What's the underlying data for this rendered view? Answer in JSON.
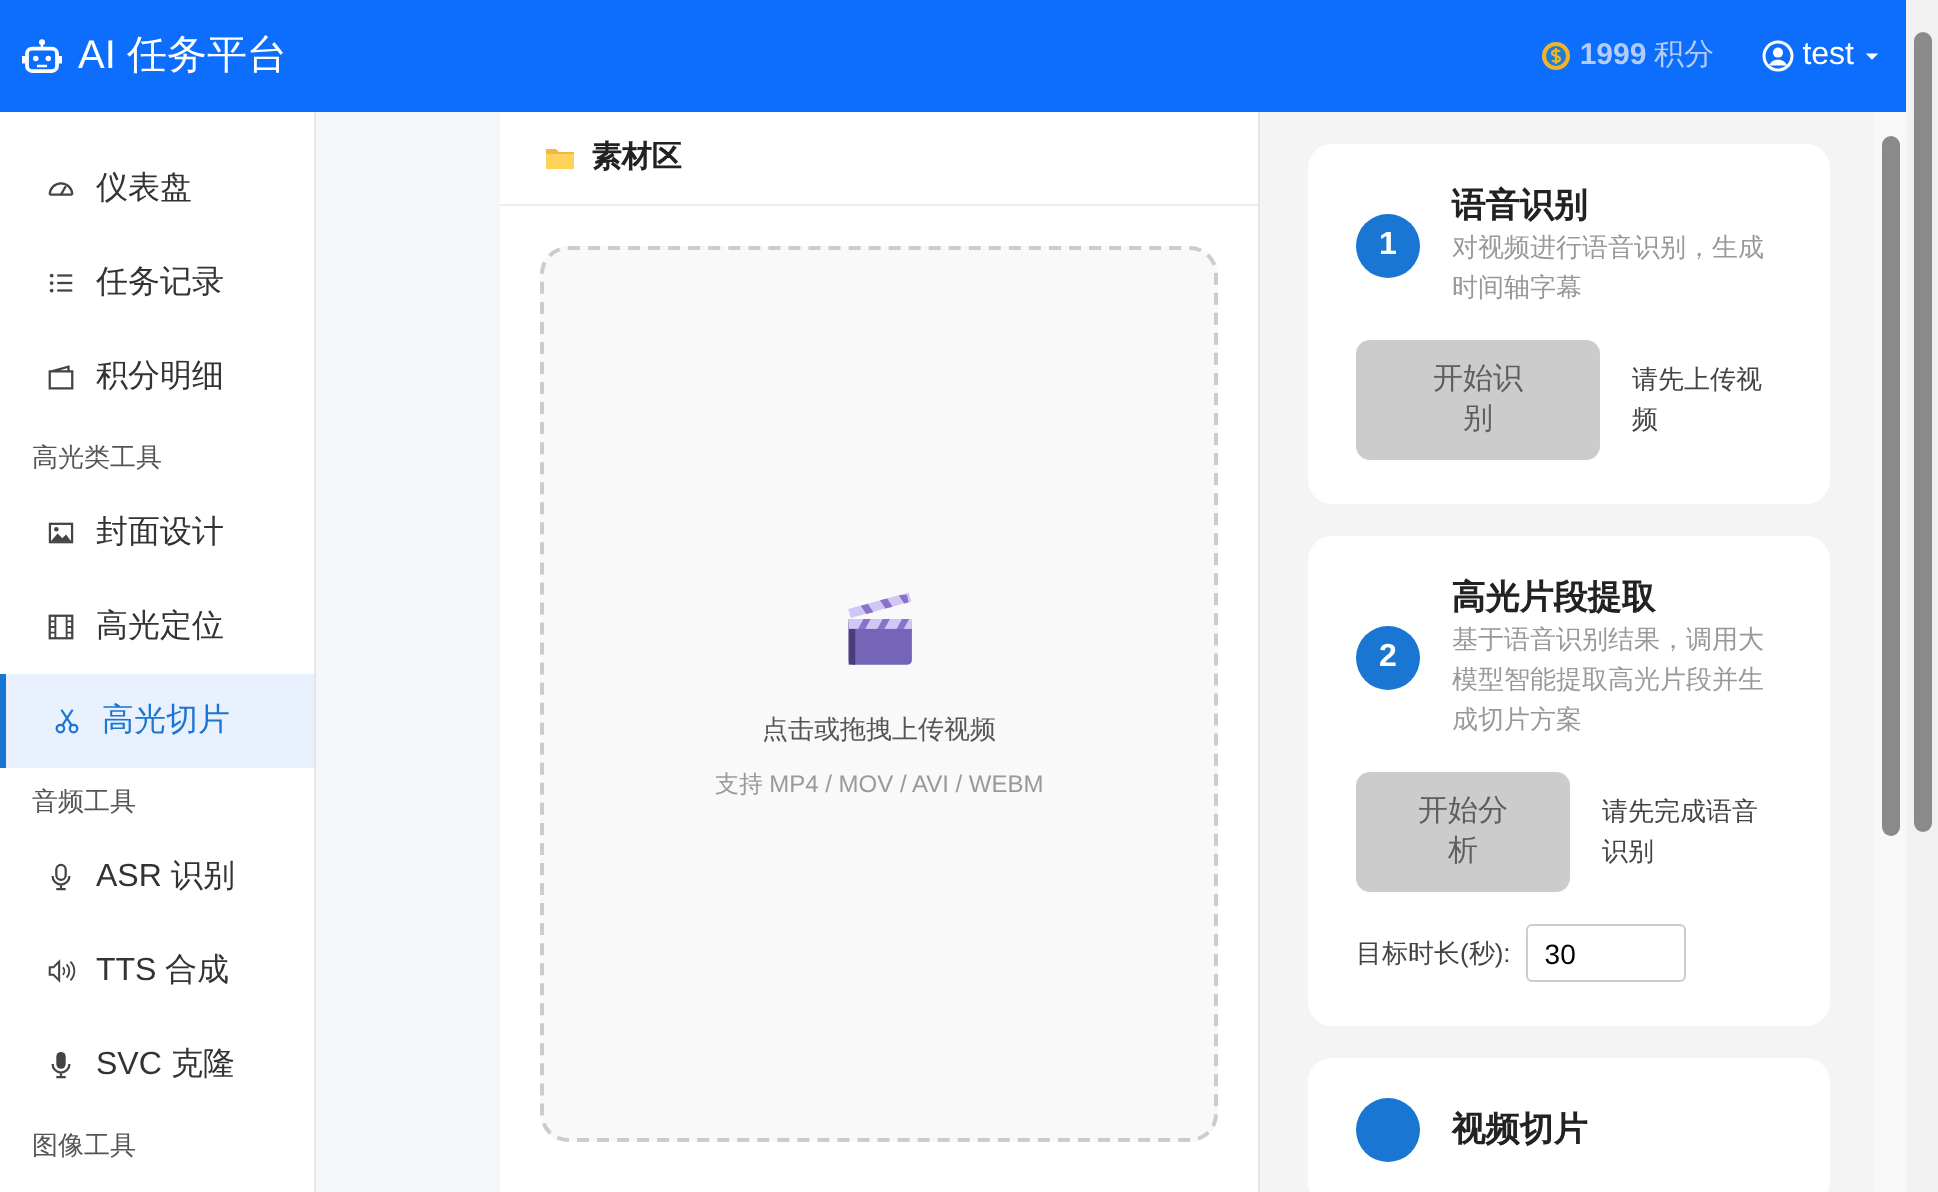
{
  "navbar": {
    "brand": "AI 任务平台",
    "points_value": "1999",
    "points_unit": "积分",
    "user": "test"
  },
  "sidebar": {
    "items": [
      {
        "kind": "link",
        "label": "仪表盘",
        "selected": false
      },
      {
        "kind": "link",
        "label": "任务记录",
        "selected": false
      },
      {
        "kind": "link",
        "label": "积分明细",
        "selected": false
      },
      {
        "kind": "heading",
        "label": "高光类工具"
      },
      {
        "kind": "link",
        "label": "封面设计",
        "selected": false
      },
      {
        "kind": "link",
        "label": "高光定位",
        "selected": false
      },
      {
        "kind": "link",
        "label": "高光切片",
        "selected": true
      },
      {
        "kind": "heading",
        "label": "音频工具"
      },
      {
        "kind": "link",
        "label": "ASR 识别",
        "selected": false
      },
      {
        "kind": "link",
        "label": "TTS 合成",
        "selected": false
      },
      {
        "kind": "link",
        "label": "SVC 克隆",
        "selected": false
      },
      {
        "kind": "heading",
        "label": "图像工具"
      }
    ]
  },
  "material": {
    "title": "素材区",
    "upload_text": "点击或拖拽上传视频",
    "upload_hint": "支持 MP4 / MOV / AVI / WEBM"
  },
  "steps": [
    {
      "number": "1",
      "title": "语音识别",
      "description": "对视频进行语音识别，生成时间轴字幕",
      "button": "开始识别",
      "disabled": true,
      "hint": "请先上传视频"
    },
    {
      "number": "2",
      "title": "高光片段提取",
      "description": "基于语音识别结果，调用大模型智能提取高光片段并生成切片方案",
      "button": "开始分析",
      "disabled": true,
      "hint": "请先完成语音识别",
      "field": {
        "label": "目标时长(秒):",
        "value": "30"
      }
    },
    {
      "title": "视频切片"
    }
  ]
}
